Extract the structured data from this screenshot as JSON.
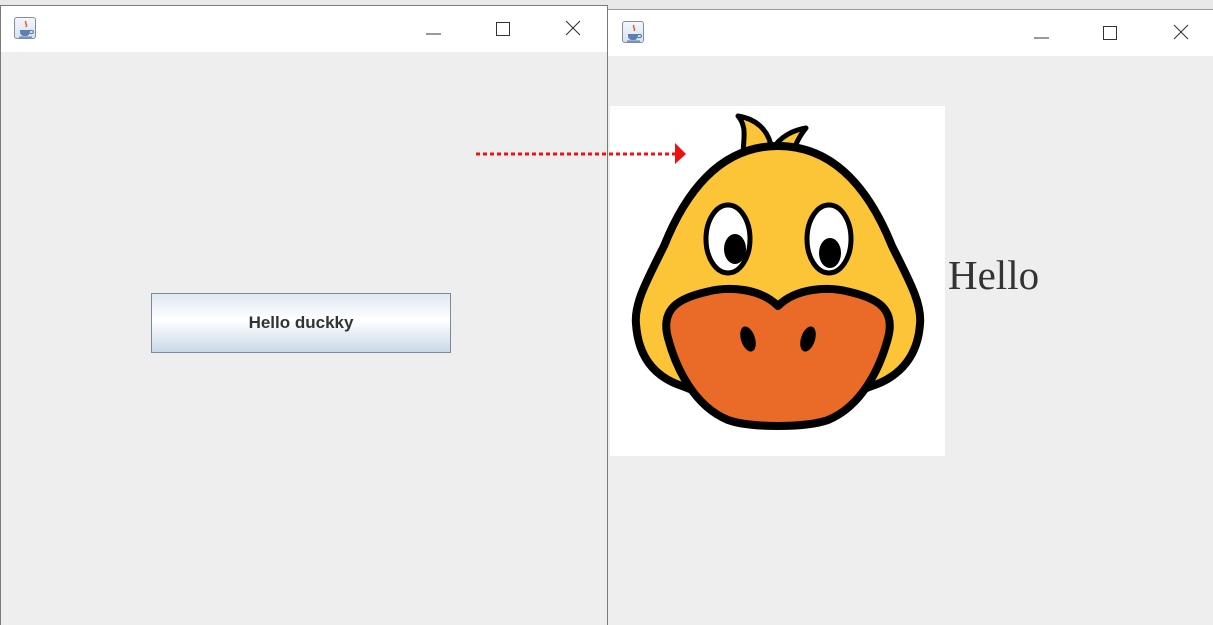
{
  "left_window": {
    "button_label": "Hello duckky"
  },
  "right_window": {
    "label_text": "Hello"
  },
  "icons": {
    "app": "java-app-icon",
    "minimize": "minimize-icon",
    "maximize": "maximize-icon",
    "close": "close-icon",
    "image": "duck-face-image"
  },
  "colors": {
    "annotation_arrow": "#ee1111",
    "duck_yellow": "#fcc437",
    "duck_beak": "#ea6a28",
    "button_border": "#7a8a99"
  }
}
